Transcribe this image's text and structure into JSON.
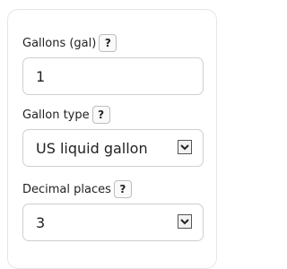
{
  "gallons": {
    "label": "Gallons (gal)",
    "help": "?",
    "value": "1"
  },
  "gallon_type": {
    "label": "Gallon type",
    "help": "?",
    "selected": "US liquid gallon"
  },
  "decimal_places": {
    "label": "Decimal places",
    "help": "?",
    "selected": "3"
  },
  "icons": {
    "help": "question-mark",
    "dropdown": "chevron-down"
  }
}
